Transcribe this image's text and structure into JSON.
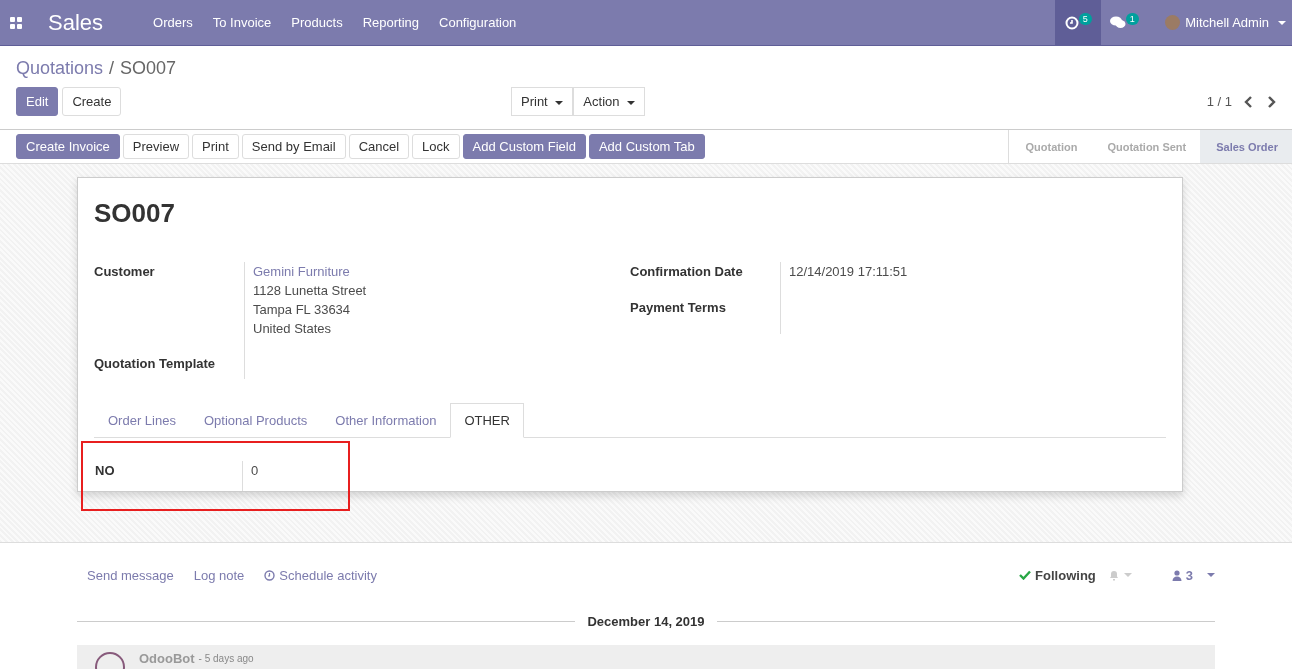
{
  "navbar": {
    "app": "Sales",
    "menu": [
      "Orders",
      "To Invoice",
      "Products",
      "Reporting",
      "Configuration"
    ],
    "activity_count": "5",
    "message_count": "1",
    "user": "Mitchell Admin"
  },
  "breadcrumb": {
    "parent": "Quotations",
    "separator": "/",
    "current": "SO007"
  },
  "control_buttons": [
    {
      "label": "Edit",
      "primary": true
    },
    {
      "label": "Create",
      "primary": false
    }
  ],
  "dropdowns": [
    "Print",
    "Action"
  ],
  "pager": "1 / 1",
  "header_buttons": [
    {
      "label": "Create Invoice",
      "primary": true
    },
    {
      "label": "Preview",
      "primary": false
    },
    {
      "label": "Print",
      "primary": false
    },
    {
      "label": "Send by Email",
      "primary": false
    },
    {
      "label": "Cancel",
      "primary": false
    },
    {
      "label": "Lock",
      "primary": false
    },
    {
      "label": "Add Custom Field",
      "primary": true
    },
    {
      "label": "Add Custom Tab",
      "primary": true
    }
  ],
  "stages": [
    {
      "label": "Quotation",
      "selected": false
    },
    {
      "label": "Quotation Sent",
      "selected": false
    },
    {
      "label": "Sales Order",
      "selected": true
    }
  ],
  "record": {
    "name": "SO007",
    "left_fields": [
      {
        "label": "Customer",
        "link": "Gemini Furniture",
        "lines": [
          "1128 Lunetta Street",
          "Tampa FL 33634",
          "United States"
        ]
      },
      {
        "label": "Quotation Template"
      }
    ],
    "right_fields": [
      {
        "label": "Confirmation Date",
        "value": "12/14/2019 17:11:51"
      },
      {
        "label": "Payment Terms"
      }
    ],
    "tabs": [
      {
        "label": "Order Lines",
        "selected": false
      },
      {
        "label": "Optional Products",
        "selected": false
      },
      {
        "label": "Other Information",
        "selected": false
      },
      {
        "label": "OTHER",
        "selected": true
      }
    ],
    "tab_field": {
      "label": "NO",
      "value": "0",
      "highlighted": true
    }
  },
  "chatter": {
    "actions": [
      "Send message",
      "Log note",
      "Schedule activity"
    ],
    "following": "Following",
    "followers": "3",
    "date": "December 14, 2019",
    "author": "OdooBot",
    "time": "- 5 days ago"
  }
}
